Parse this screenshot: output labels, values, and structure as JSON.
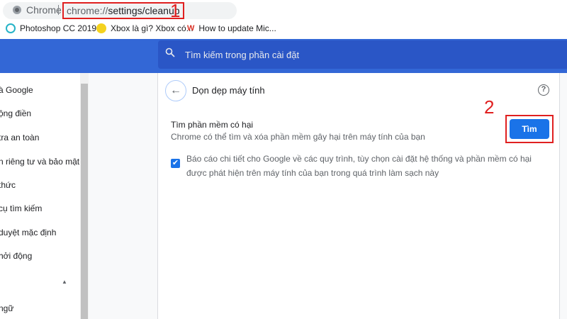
{
  "browser": {
    "app_label": "Chrome",
    "url_prefix": "chrome://",
    "url_path": "settings/cleanup"
  },
  "annotations": {
    "step1": "1",
    "step2": "2"
  },
  "bookmarks": [
    {
      "label": "Photoshop CC 2019..."
    },
    {
      "label": "Xbox là gì? Xbox có..."
    },
    {
      "label": "How to update Mic..."
    }
  ],
  "search": {
    "placeholder": "Tìm kiếm trong phần cài đặt"
  },
  "sidebar": {
    "items": [
      {
        "label": "à Google"
      },
      {
        "label": "ộng điền"
      },
      {
        "label": "tra an toàn"
      },
      {
        "label": "n riêng tư và bảo mật"
      },
      {
        "label": "thức"
      },
      {
        "label": "cụ tìm kiếm"
      },
      {
        "label": "duyệt mặc định"
      },
      {
        "label": "hởi động"
      },
      {
        "label": "ngữ"
      }
    ]
  },
  "page": {
    "title": "Dọn dẹp máy tính",
    "section_title": "Tìm phần mềm có hại",
    "section_desc": "Chrome có thể tìm và xóa phần mềm gây hại trên máy tính của bạn",
    "find_button": "Tìm",
    "checkbox_label": "Báo cáo chi tiết cho Google về các quy trình, tùy chọn cài đặt hệ thống và phần mềm có hại được phát hiện trên máy tính của bạn trong quá trình làm sạch này",
    "checkbox_checked": true
  }
}
